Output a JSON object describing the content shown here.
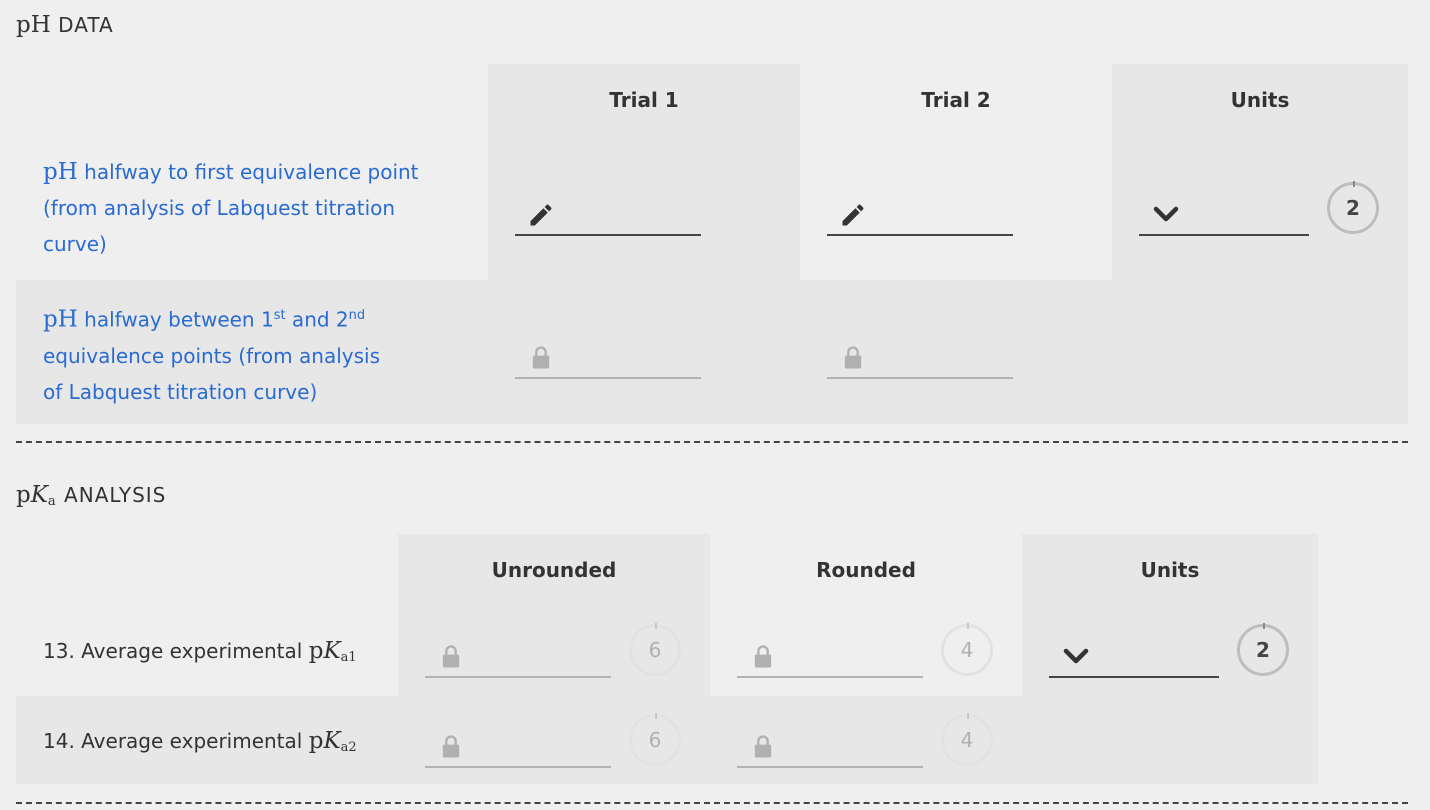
{
  "ph_section": {
    "title_math": "pH",
    "title_text": "DATA",
    "columns": {
      "trial1": "Trial 1",
      "trial2": "Trial 2",
      "units": "Units"
    },
    "row1": {
      "label_math": "pH",
      "label_line1": " halfway to first equivalence point",
      "label_line2": "(from analysis of Labquest titration",
      "label_line3": "curve)"
    },
    "row2": {
      "label_math": "pH",
      "label_part1": " halfway between 1",
      "sup1": "st",
      "label_part2": " and 2",
      "sup2": "nd",
      "label_line2": "equivalence points (from analysis",
      "label_line3": "of Labquest titration curve)"
    },
    "units_sigfig": "2"
  },
  "pka_section": {
    "title_math_p": "p",
    "title_math_k": "K",
    "title_sub": "a",
    "title_text": "ANALYSIS",
    "columns": {
      "unrounded": "Unrounded",
      "rounded": "Rounded",
      "units": "Units"
    },
    "row13": {
      "label": "13. Average experimental ",
      "math_p": "p",
      "math_k": "K",
      "sub": "a1",
      "unrounded_sigfig": "6",
      "rounded_sigfig": "4",
      "units_sigfig": "2"
    },
    "row14": {
      "label": "14. Average experimental ",
      "math_p": "p",
      "math_k": "K",
      "sub": "a2",
      "unrounded_sigfig": "6",
      "rounded_sigfig": "4"
    }
  },
  "icons": {
    "edit": "pencil-icon",
    "locked": "lock-icon",
    "dropdown": "chevron-down-icon"
  },
  "colors": {
    "link_blue": "#2a6bd1",
    "column_bg": "#e7e7e7",
    "page_bg": "#efefef"
  }
}
